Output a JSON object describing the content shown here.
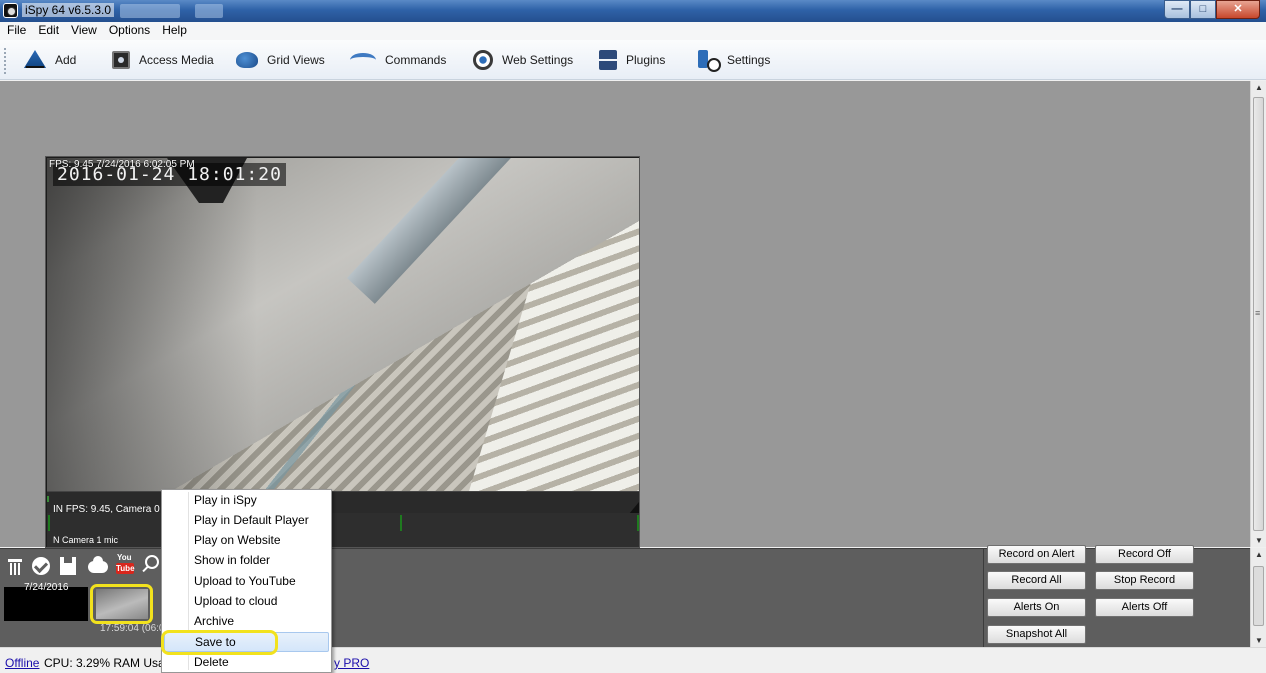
{
  "window": {
    "title": "iSpy 64 v6.5.3.0",
    "buttons": {
      "minimize": "—",
      "maximize": "□",
      "close": "✕"
    }
  },
  "menu": [
    "File",
    "Edit",
    "View",
    "Options",
    "Help"
  ],
  "toolbar": {
    "add": "Add",
    "access_media": "Access Media",
    "grid_views": "Grid Views",
    "commands": "Commands",
    "web_settings": "Web Settings",
    "plugins": "Plugins",
    "settings": "Settings"
  },
  "camera": {
    "overlay_fps": "FPS: 9.45 7/24/2016 6:02:05 PM",
    "osd_datetime": "2016-01-24  18:01:20",
    "status_line": "IN  FPS: 9.45, Camera 0",
    "mic_line": "N  Camera 1 mic"
  },
  "media_panel": {
    "youtube_top": "You",
    "youtube_bottom": "Tube",
    "thumb_date": "7/24/2016",
    "thumb_time": "17:59:04 (06:0"
  },
  "context_menu": {
    "items": [
      "Play in iSpy",
      "Play in Default Player",
      "Play on Website",
      "Show in folder",
      "Upload to YouTube",
      "Upload to cloud",
      "Archive",
      "Save to",
      "Delete"
    ],
    "highlighted": "Save to"
  },
  "commands": {
    "record_on_alert": "Record on Alert",
    "record_off": "Record Off",
    "record_all": "Record All",
    "stop_record": "Stop Record",
    "alerts_on": "Alerts On",
    "alerts_off": "Alerts Off",
    "snapshot_all": "Snapshot All"
  },
  "status": {
    "connection": "Offline",
    "cpu": "CPU: 3.29% RAM Usage",
    "pro": "y PRO"
  },
  "colors": {
    "highlight_annotation": "#f2e21d",
    "main_bg": "#989898",
    "panel_bg": "#5e5e5e"
  }
}
